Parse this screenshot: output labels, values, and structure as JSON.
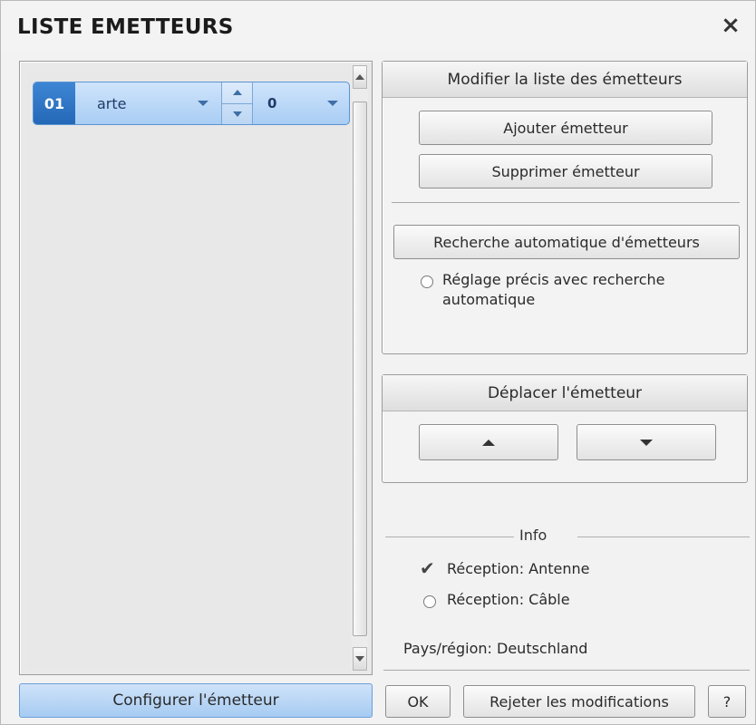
{
  "window": {
    "title": "LISTE EMETTEURS",
    "close_label": "×"
  },
  "channel_list": {
    "items": [
      {
        "number": "01",
        "name": "arte",
        "sub_value": "0"
      }
    ]
  },
  "modify_group": {
    "header": "Modifier la liste des émetteurs",
    "add_label": "Ajouter émetteur",
    "delete_label": "Supprimer émetteur",
    "auto_search_label": "Recherche automatique d'émetteurs",
    "fine_tune_label_line1": "Réglage précis avec recherche",
    "fine_tune_label_line2": "automatique",
    "fine_tune_checked": false
  },
  "move_group": {
    "header": "Déplacer l'émetteur",
    "up_icon": "arrow-up-icon",
    "down_icon": "arrow-down-icon"
  },
  "info": {
    "title": "Info",
    "reception_antenna": "Réception: Antenne",
    "reception_antenna_checked": true,
    "reception_cable": "Réception: Câble",
    "reception_cable_checked": false,
    "country": "Pays/région: Deutschland"
  },
  "footer": {
    "configure_label": "Configurer l'émetteur",
    "ok_label": "OK",
    "reject_label": "Rejeter les modifications",
    "help_label": "?"
  },
  "colors": {
    "selection_blue": "#2468b8",
    "row_highlight": "#a9cdf4",
    "configure_button": "#a6cbf2"
  }
}
